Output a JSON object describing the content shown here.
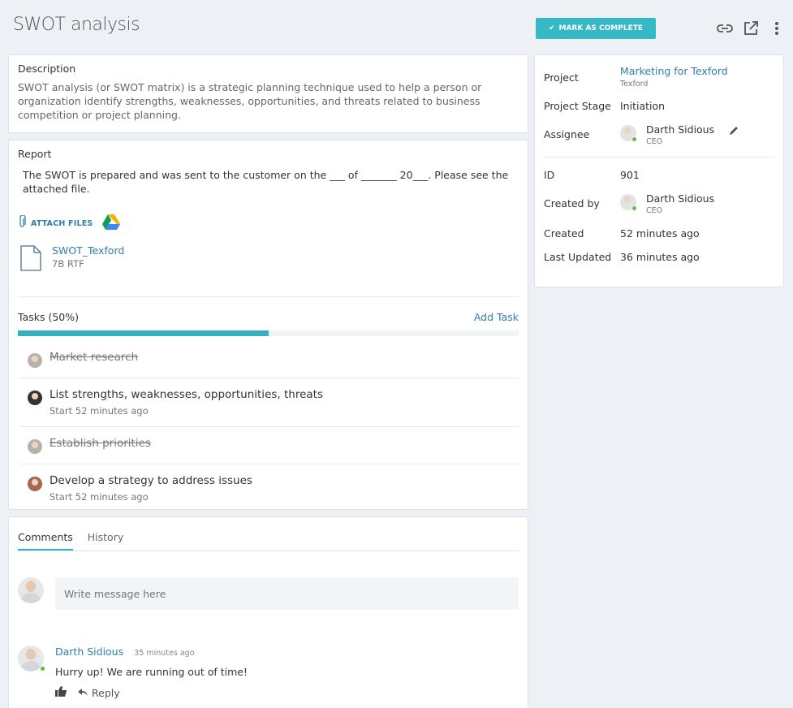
{
  "header": {
    "title": "SWOT analysis",
    "complete_label": "MARK AS COMPLETE"
  },
  "description": {
    "label": "Description",
    "text": "SWOT analysis (or SWOT matrix) is a strategic planning technique used to help a person or organization identify strengths, weaknesses, opportunities, and threats related to business competition or project planning."
  },
  "report": {
    "label": "Report",
    "text": "The SWOT is prepared and was sent to the customer on the ___ of _______ 20___. Please see the attached file.",
    "attach_label": "ATTACH FILES",
    "file": {
      "name": "SWOT_Texford",
      "meta": "7B RTF"
    }
  },
  "tasks": {
    "label": "Tasks (50%)",
    "progress": 0.5,
    "add_label": "Add Task",
    "items": [
      {
        "title": "Market research",
        "done": true,
        "meta": ""
      },
      {
        "title": "List strengths, weaknesses, opportunities, threats",
        "done": false,
        "meta": "Start  52 minutes ago"
      },
      {
        "title": "Establish priorities",
        "done": true,
        "meta": ""
      },
      {
        "title": "Develop a strategy to address issues",
        "done": false,
        "meta": "Start  52 minutes ago"
      }
    ]
  },
  "side": {
    "project_label": "Project",
    "project_name": "Marketing for Texford",
    "project_client": "Texford",
    "stage_label": "Project Stage",
    "stage_value": "Initiation",
    "assignee_label": "Assignee",
    "assignee_name": "Darth Sidious",
    "assignee_role": "CEO",
    "id_label": "ID",
    "id_value": "901",
    "created_by_label": "Created by",
    "created_by_name": "Darth Sidious",
    "created_by_role": "CEO",
    "created_label": "Created",
    "created_value": "52 minutes ago",
    "updated_label": "Last Updated",
    "updated_value": "36 minutes ago"
  },
  "comments": {
    "tab_comments": "Comments",
    "tab_history": "History",
    "placeholder": "Write message here",
    "items": [
      {
        "author": "Darth Sidious",
        "time": "35 minutes ago",
        "text": "Hurry up! We are running out of time!",
        "reply_label": "Reply"
      }
    ]
  }
}
